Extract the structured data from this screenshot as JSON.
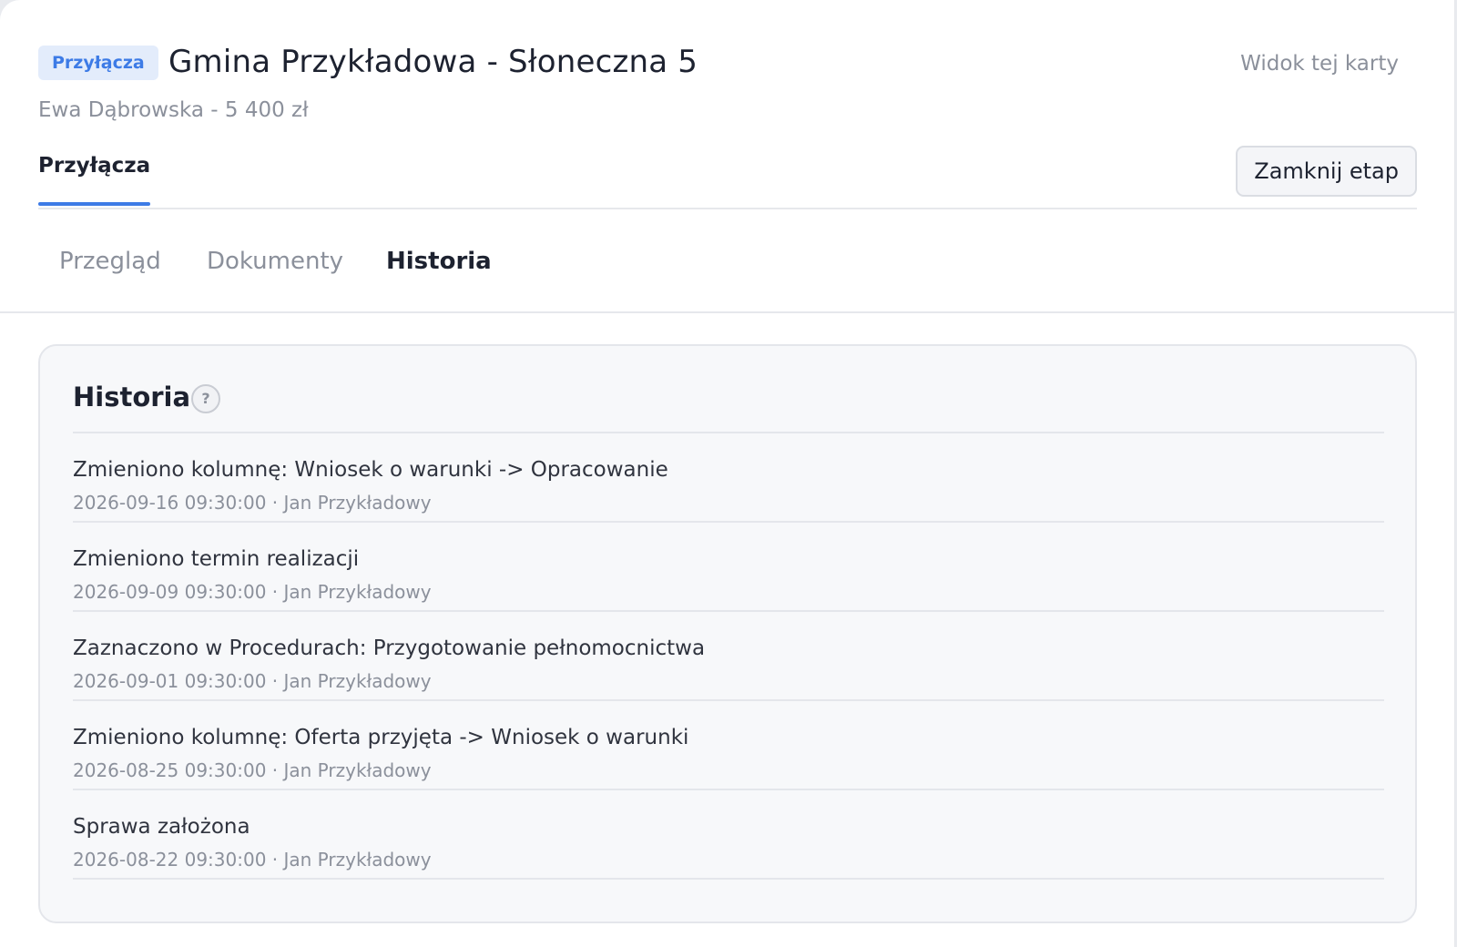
{
  "header": {
    "badge": "Przyłącza",
    "title": "Gmina Przykładowa - Słoneczna 5",
    "view_link": "Widok tej karty",
    "subtitle": "Ewa Dąbrowska - 5 400 zł"
  },
  "stage": {
    "active_tab": "Przyłącza",
    "close_button": "Zamknij etap"
  },
  "section_tabs": [
    {
      "label": "Przegląd",
      "active": false
    },
    {
      "label": "Dokumenty",
      "active": false
    },
    {
      "label": "Historia",
      "active": true
    }
  ],
  "history": {
    "title": "Historia",
    "help_icon": "?",
    "entries": [
      {
        "text": "Zmieniono kolumnę: Wniosek o warunki -> Opracowanie",
        "meta": "2026-09-16 09:30:00 · Jan Przykładowy"
      },
      {
        "text": "Zmieniono termin realizacji",
        "meta": "2026-09-09 09:30:00 · Jan Przykładowy"
      },
      {
        "text": "Zaznaczono w Procedurach: Przygotowanie pełnomocnictwa",
        "meta": "2026-09-01 09:30:00 · Jan Przykładowy"
      },
      {
        "text": "Zmieniono kolumnę: Oferta przyjęta -> Wniosek o warunki",
        "meta": "2026-08-25 09:30:00 · Jan Przykładowy"
      },
      {
        "text": "Sprawa założona",
        "meta": "2026-08-22 09:30:00 · Jan Przykładowy"
      }
    ]
  },
  "colors": {
    "accent": "#3d7be6",
    "badge_bg": "#e3ecfb",
    "text_primary": "#1d2230",
    "text_muted": "#8b909b",
    "card_bg": "#f7f8fa"
  }
}
